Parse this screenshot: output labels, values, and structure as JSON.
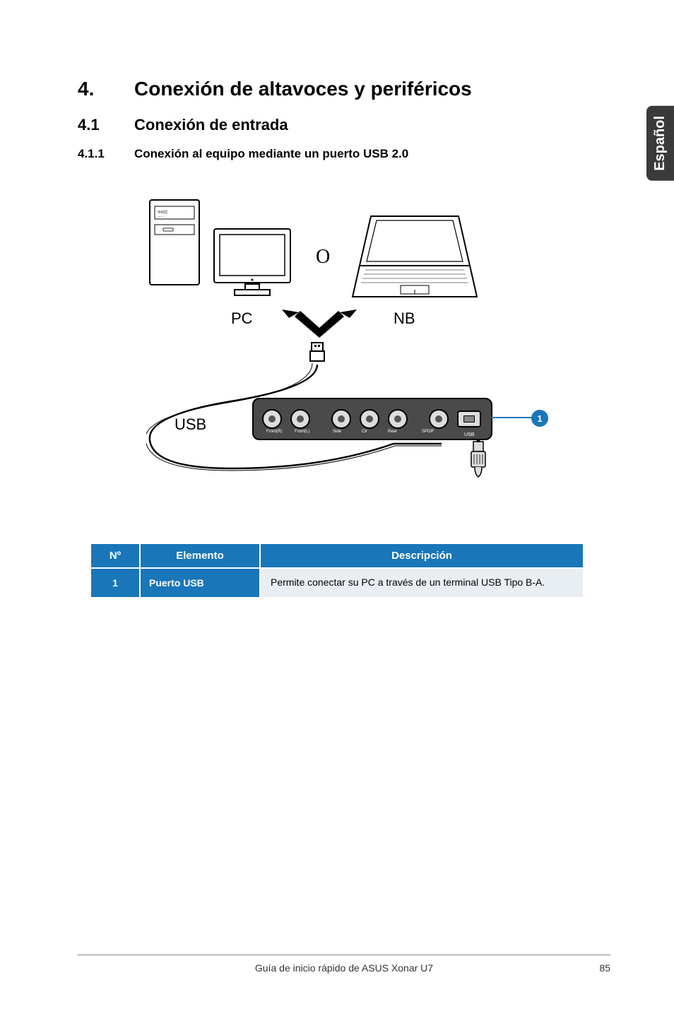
{
  "language_tab": "Español",
  "heading1": {
    "num": "4.",
    "text": "Conexión de altavoces y periféricos"
  },
  "heading2": {
    "num": "4.1",
    "text": "Conexión de entrada"
  },
  "heading3": {
    "num": "4.1.1",
    "text": "Conexión al equipo mediante un puerto USB 2.0"
  },
  "diagram": {
    "or": "O",
    "pc": "PC",
    "nb": "NB",
    "usb": "USB",
    "ports": [
      "Front(R)",
      "Front(L)",
      "Side",
      "Ctr",
      "Rear",
      "SPDIF"
    ],
    "usb_port_label": "USB",
    "callout": "1"
  },
  "table": {
    "headers": {
      "no": "Nº",
      "item": "Elemento",
      "desc": "Descripción"
    },
    "rows": [
      {
        "no": "1",
        "item": "Puerto USB",
        "desc": "Permite conectar su PC a través de un terminal USB Tipo B-A."
      }
    ]
  },
  "footer": {
    "title": "Guía de inicio rápido de ASUS Xonar U7",
    "page": "85"
  }
}
